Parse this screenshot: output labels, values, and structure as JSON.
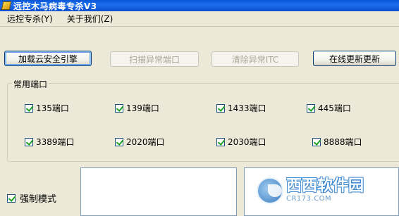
{
  "window": {
    "title": "远控木马病毒专杀V3"
  },
  "menu": {
    "items": [
      {
        "label": "远控专杀(Y)"
      },
      {
        "label": "关于我们(Z)"
      }
    ]
  },
  "toolbar": {
    "load_engine": "加载云安全引擎",
    "scan_ports": "扫描异常端口",
    "clear_itc": "清除异常ITC",
    "online_update": "在线更新更新"
  },
  "ports_group": {
    "legend": "常用端口",
    "ports": [
      {
        "label": "135端口",
        "checked": true
      },
      {
        "label": "139端口",
        "checked": true
      },
      {
        "label": "1433端口",
        "checked": true
      },
      {
        "label": "445端口",
        "checked": true
      },
      {
        "label": "3389端口",
        "checked": true
      },
      {
        "label": "2020端口",
        "checked": true
      },
      {
        "label": "2030端口",
        "checked": true
      },
      {
        "label": "8888端口",
        "checked": true
      }
    ]
  },
  "force_mode": {
    "label": "强制模式",
    "checked": true
  },
  "watermark": {
    "main": "西西软件园",
    "sub": "CR173.COM"
  }
}
